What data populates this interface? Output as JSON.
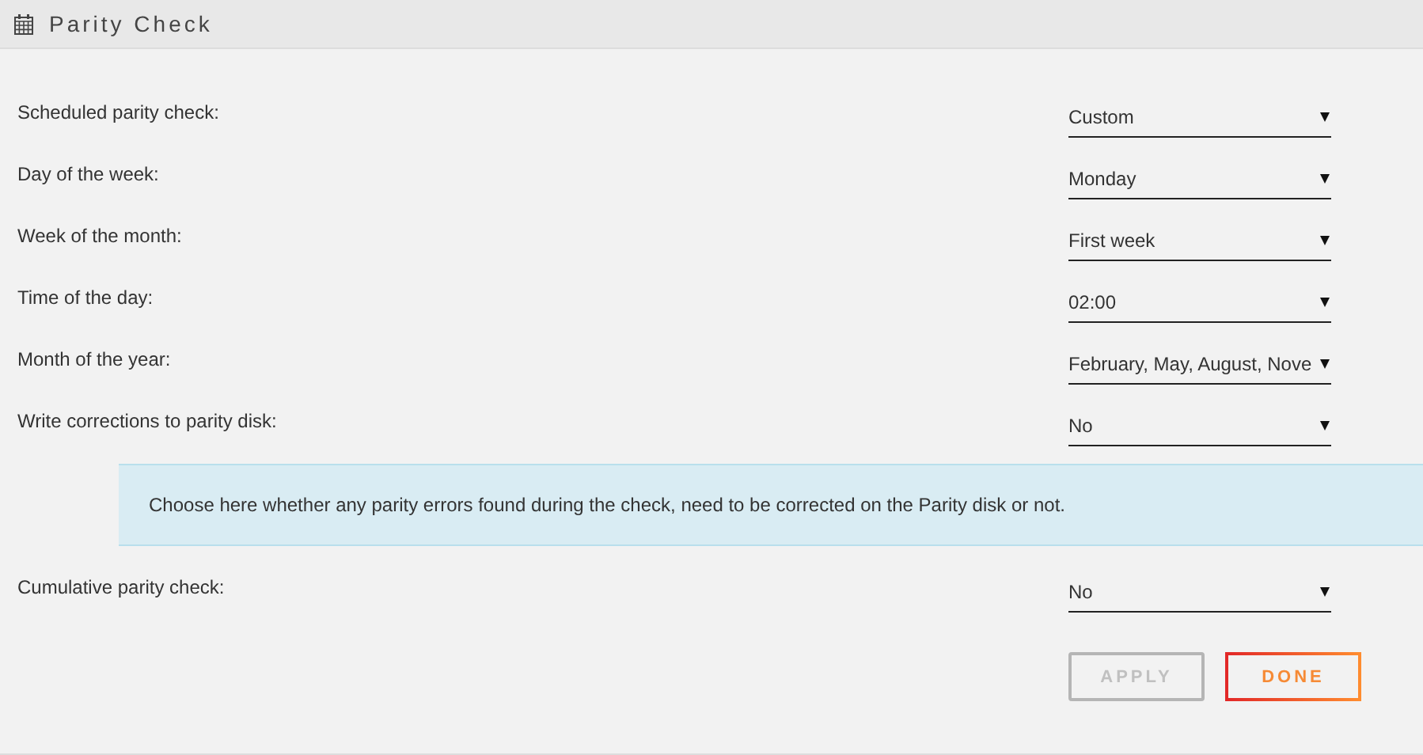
{
  "panel": {
    "title": "Parity Check"
  },
  "settings": [
    {
      "label": "Scheduled parity check:",
      "value": "Custom"
    },
    {
      "label": "Day of the week:",
      "value": "Monday"
    },
    {
      "label": "Week of the month:",
      "value": "First week"
    },
    {
      "label": "Time of the day:",
      "value": "02:00"
    },
    {
      "label": "Month of the year:",
      "value": "February, May, August, Nove"
    },
    {
      "label": "Write corrections to parity disk:",
      "value": "No",
      "help": "Choose here whether any parity errors found during the check, need to be corrected on the Parity disk or not."
    },
    {
      "label": "Cumulative parity check:",
      "value": "No"
    }
  ],
  "buttons": [
    {
      "label": "APPLY",
      "disabled": true
    },
    {
      "label": "DONE",
      "disabled": false
    }
  ]
}
